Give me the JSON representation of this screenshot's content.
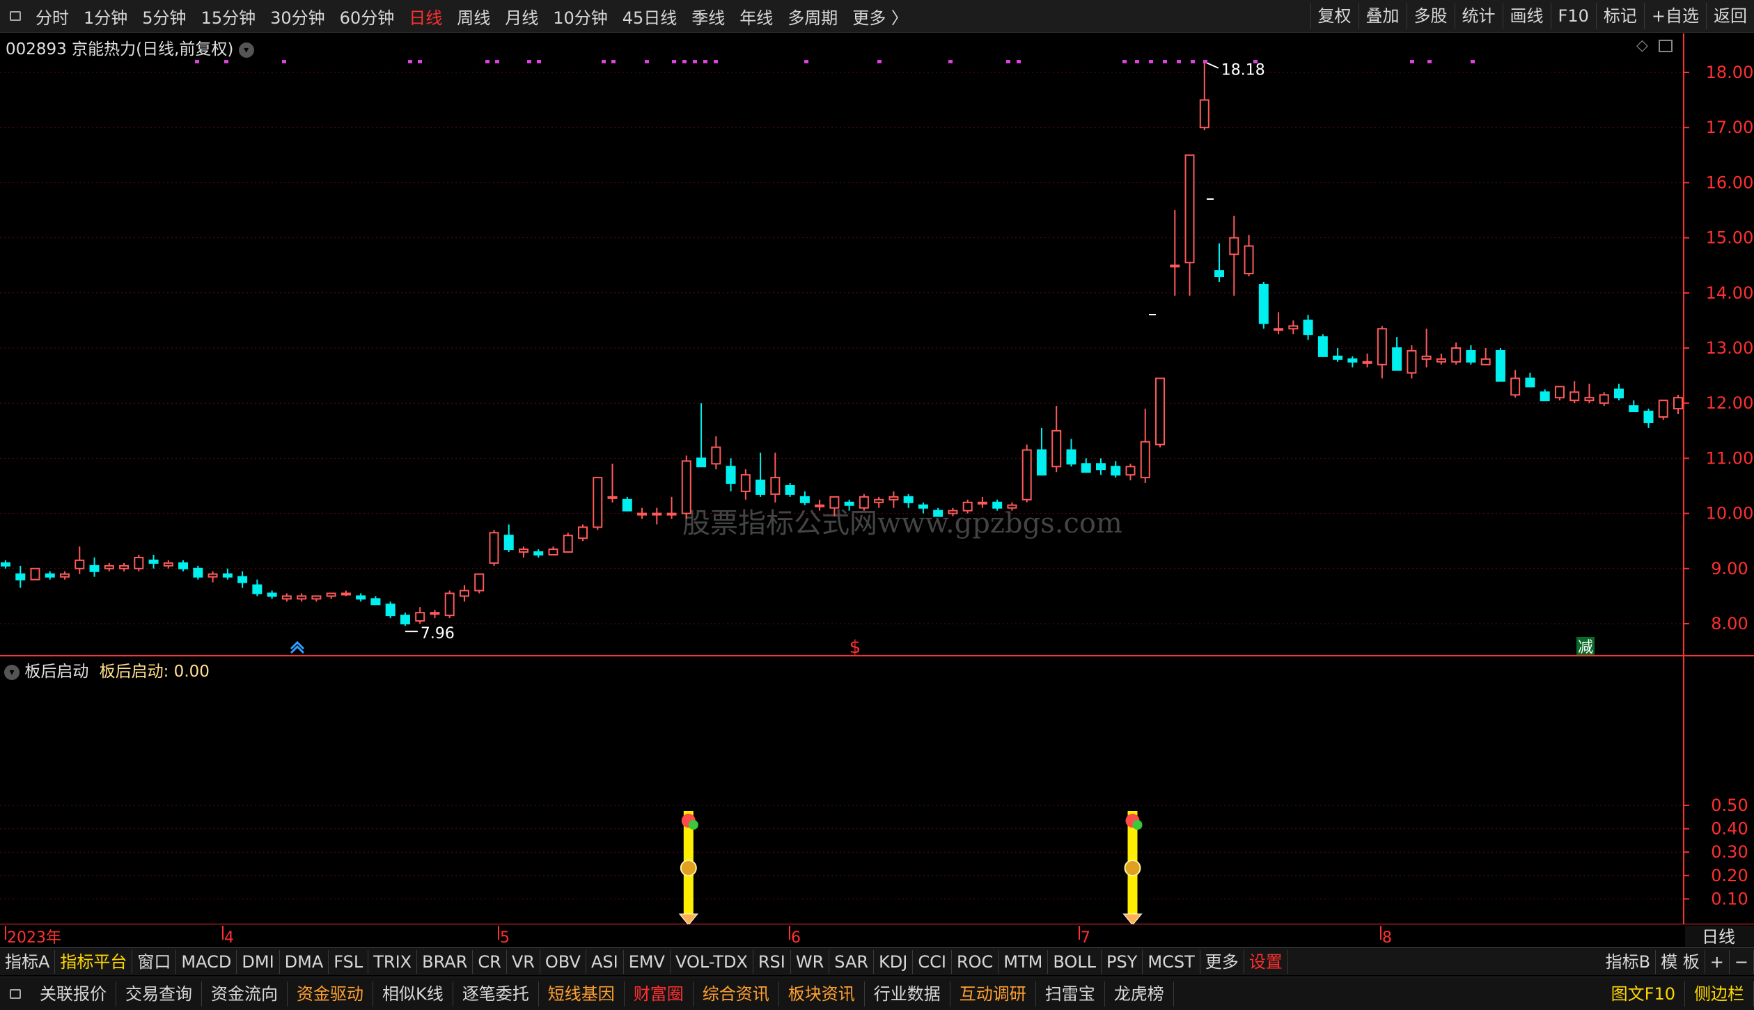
{
  "top_toolbar": {
    "periods": [
      {
        "label": "分时",
        "active": false
      },
      {
        "label": "1分钟",
        "active": false
      },
      {
        "label": "5分钟",
        "active": false
      },
      {
        "label": "15分钟",
        "active": false
      },
      {
        "label": "30分钟",
        "active": false
      },
      {
        "label": "60分钟",
        "active": false
      },
      {
        "label": "日线",
        "active": true
      },
      {
        "label": "周线",
        "active": false
      },
      {
        "label": "月线",
        "active": false
      },
      {
        "label": "10分钟",
        "active": false
      },
      {
        "label": "45日线",
        "active": false
      },
      {
        "label": "季线",
        "active": false
      },
      {
        "label": "年线",
        "active": false
      },
      {
        "label": "多周期",
        "active": false
      },
      {
        "label": "更多 〉",
        "active": false
      }
    ],
    "right_buttons": [
      "复权",
      "叠加",
      "多股",
      "统计",
      "画线",
      "F10",
      "标记",
      "+自选",
      "返回"
    ]
  },
  "main_panel": {
    "title": "002893 京能热力(日线,前复权)",
    "high_label": "18.18",
    "low_label": "7.96",
    "watermark": "股票指标公式网www.gpzbgs.com",
    "marker_reduce": "减",
    "marker_dollar": "$",
    "price_axis": [
      "18.00",
      "17.00",
      "16.00",
      "15.00",
      "14.00",
      "13.00",
      "12.00",
      "11.00",
      "10.00",
      "9.00",
      "8.00"
    ]
  },
  "sub_panel": {
    "title": "板后启动",
    "value_label": "板后启动: 0.00",
    "axis": [
      "0.50",
      "0.40",
      "0.30",
      "0.20",
      "0.10"
    ],
    "signal_icons": [
      "flower-icon",
      "dollar-coin-icon",
      "diamond-icon",
      "butterfly-icon"
    ]
  },
  "time_axis": {
    "labels": [
      "2023年",
      "4",
      "5",
      "6",
      "7",
      "8"
    ],
    "right_label": "日线"
  },
  "indicator_bar": {
    "items": [
      {
        "label": "指标A",
        "style": "normal"
      },
      {
        "label": "指标平台",
        "style": "hl"
      },
      {
        "label": "窗口",
        "style": "normal"
      },
      {
        "label": "MACD",
        "style": "normal"
      },
      {
        "label": "DMI",
        "style": "normal"
      },
      {
        "label": "DMA",
        "style": "normal"
      },
      {
        "label": "FSL",
        "style": "normal"
      },
      {
        "label": "TRIX",
        "style": "normal"
      },
      {
        "label": "BRAR",
        "style": "normal"
      },
      {
        "label": "CR",
        "style": "normal"
      },
      {
        "label": "VR",
        "style": "normal"
      },
      {
        "label": "OBV",
        "style": "normal"
      },
      {
        "label": "ASI",
        "style": "normal"
      },
      {
        "label": "EMV",
        "style": "normal"
      },
      {
        "label": "VOL-TDX",
        "style": "normal"
      },
      {
        "label": "RSI",
        "style": "normal"
      },
      {
        "label": "WR",
        "style": "normal"
      },
      {
        "label": "SAR",
        "style": "normal"
      },
      {
        "label": "KDJ",
        "style": "normal"
      },
      {
        "label": "CCI",
        "style": "normal"
      },
      {
        "label": "ROC",
        "style": "normal"
      },
      {
        "label": "MTM",
        "style": "normal"
      },
      {
        "label": "BOLL",
        "style": "normal"
      },
      {
        "label": "PSY",
        "style": "normal"
      },
      {
        "label": "MCST",
        "style": "normal"
      },
      {
        "label": "更多",
        "style": "normal"
      },
      {
        "label": "设置",
        "style": "red"
      }
    ],
    "right": [
      "指标B",
      "模 板",
      "+",
      "−"
    ]
  },
  "function_bar": {
    "items": [
      {
        "label": "关联报价",
        "color": "white"
      },
      {
        "label": "交易查询",
        "color": "white"
      },
      {
        "label": "资金流向",
        "color": "white"
      },
      {
        "label": "资金驱动",
        "color": "orange"
      },
      {
        "label": "相似K线",
        "color": "white"
      },
      {
        "label": "逐笔委托",
        "color": "white"
      },
      {
        "label": "短线基因",
        "color": "orange"
      },
      {
        "label": "财富圈",
        "color": "red"
      },
      {
        "label": "综合资讯",
        "color": "orange"
      },
      {
        "label": "板块资讯",
        "color": "orange"
      },
      {
        "label": "行业数据",
        "color": "white"
      },
      {
        "label": "互动调研",
        "color": "orange"
      },
      {
        "label": "扫雷宝",
        "color": "white"
      },
      {
        "label": "龙虎榜",
        "color": "white"
      }
    ],
    "right": [
      {
        "label": "图文F10",
        "color": "yellow"
      },
      {
        "label": "侧边栏",
        "color": "yellow"
      }
    ]
  },
  "colors": {
    "up": "#ff5a5a",
    "down": "#00f0f0",
    "grid": "#5a1010",
    "axis": "#ff3030",
    "signal": "#ffee00"
  },
  "chart_data": {
    "type": "candlestick",
    "ohlc": [
      [
        9.1,
        9.15,
        9.0,
        9.05
      ],
      [
        8.9,
        9.05,
        8.65,
        8.8
      ],
      [
        8.8,
        9.0,
        8.8,
        9.0
      ],
      [
        8.9,
        8.95,
        8.8,
        8.85
      ],
      [
        8.85,
        8.95,
        8.8,
        8.9
      ],
      [
        9.0,
        9.4,
        8.9,
        9.15
      ],
      [
        9.05,
        9.2,
        8.85,
        8.95
      ],
      [
        9.0,
        9.1,
        8.95,
        9.05
      ],
      [
        9.0,
        9.1,
        8.95,
        9.05
      ],
      [
        9.0,
        9.25,
        8.95,
        9.2
      ],
      [
        9.15,
        9.25,
        9.0,
        9.1
      ],
      [
        9.05,
        9.15,
        9.0,
        9.1
      ],
      [
        9.1,
        9.15,
        8.95,
        9.0
      ],
      [
        9.0,
        9.05,
        8.8,
        8.85
      ],
      [
        8.85,
        8.95,
        8.75,
        8.9
      ],
      [
        8.9,
        9.0,
        8.8,
        8.85
      ],
      [
        8.85,
        8.95,
        8.65,
        8.75
      ],
      [
        8.7,
        8.8,
        8.5,
        8.55
      ],
      [
        8.55,
        8.6,
        8.45,
        8.5
      ],
      [
        8.45,
        8.55,
        8.4,
        8.5
      ],
      [
        8.45,
        8.55,
        8.4,
        8.5
      ],
      [
        8.45,
        8.5,
        8.4,
        8.5
      ],
      [
        8.5,
        8.55,
        8.45,
        8.55
      ],
      [
        8.55,
        8.6,
        8.5,
        8.55
      ],
      [
        8.5,
        8.55,
        8.4,
        8.45
      ],
      [
        8.45,
        8.5,
        8.35,
        8.35
      ],
      [
        8.35,
        8.4,
        8.1,
        8.15
      ],
      [
        8.15,
        8.2,
        7.96,
        8.0
      ],
      [
        8.05,
        8.3,
        8.0,
        8.2
      ],
      [
        8.2,
        8.25,
        8.1,
        8.2
      ],
      [
        8.15,
        8.6,
        8.1,
        8.55
      ],
      [
        8.5,
        8.7,
        8.4,
        8.6
      ],
      [
        8.6,
        8.9,
        8.55,
        8.9
      ],
      [
        9.1,
        9.7,
        9.05,
        9.65
      ],
      [
        9.6,
        9.8,
        9.3,
        9.35
      ],
      [
        9.3,
        9.4,
        9.2,
        9.35
      ],
      [
        9.3,
        9.35,
        9.2,
        9.25
      ],
      [
        9.25,
        9.4,
        9.25,
        9.35
      ],
      [
        9.3,
        9.65,
        9.3,
        9.6
      ],
      [
        9.55,
        9.8,
        9.5,
        9.75
      ],
      [
        9.75,
        10.65,
        9.7,
        10.65
      ],
      [
        10.3,
        10.9,
        10.2,
        10.3
      ],
      [
        10.25,
        10.3,
        10.05,
        10.05
      ],
      [
        10.0,
        10.1,
        9.9,
        10.0
      ],
      [
        10.0,
        10.1,
        9.8,
        10.0
      ],
      [
        10.0,
        10.3,
        9.9,
        10.0
      ],
      [
        10.0,
        11.05,
        9.9,
        10.95
      ],
      [
        11.0,
        12.0,
        10.85,
        10.85
      ],
      [
        10.9,
        11.4,
        10.8,
        11.2
      ],
      [
        10.85,
        11.0,
        10.4,
        10.55
      ],
      [
        10.4,
        10.8,
        10.25,
        10.7
      ],
      [
        10.6,
        11.1,
        10.3,
        10.35
      ],
      [
        10.35,
        11.1,
        10.2,
        10.65
      ],
      [
        10.5,
        10.55,
        10.3,
        10.35
      ],
      [
        10.3,
        10.4,
        10.15,
        10.2
      ],
      [
        10.15,
        10.25,
        10.05,
        10.15
      ],
      [
        10.1,
        10.3,
        9.95,
        10.3
      ],
      [
        10.2,
        10.25,
        10.05,
        10.15
      ],
      [
        10.1,
        10.35,
        10.05,
        10.3
      ],
      [
        10.2,
        10.3,
        10.1,
        10.25
      ],
      [
        10.25,
        10.4,
        10.1,
        10.3
      ],
      [
        10.3,
        10.35,
        10.1,
        10.2
      ],
      [
        10.15,
        10.2,
        10.0,
        10.1
      ],
      [
        10.05,
        10.1,
        9.95,
        9.95
      ],
      [
        10.0,
        10.1,
        9.95,
        10.05
      ],
      [
        10.05,
        10.25,
        10.0,
        10.2
      ],
      [
        10.2,
        10.3,
        10.1,
        10.2
      ],
      [
        10.2,
        10.25,
        10.05,
        10.1
      ],
      [
        10.1,
        10.2,
        10.05,
        10.15
      ],
      [
        10.25,
        11.25,
        10.2,
        11.15
      ],
      [
        11.15,
        11.55,
        10.85,
        10.7
      ],
      [
        10.85,
        11.95,
        10.75,
        11.5
      ],
      [
        11.15,
        11.35,
        10.85,
        10.9
      ],
      [
        10.9,
        11.0,
        10.75,
        10.75
      ],
      [
        10.9,
        11.0,
        10.7,
        10.8
      ],
      [
        10.85,
        10.95,
        10.65,
        10.7
      ],
      [
        10.7,
        10.9,
        10.6,
        10.85
      ],
      [
        10.65,
        11.9,
        10.55,
        11.3
      ],
      [
        11.25,
        12.45,
        11.2,
        12.45
      ],
      [
        14.5,
        15.5,
        13.95,
        14.5
      ],
      [
        14.55,
        16.5,
        13.95,
        16.5
      ],
      [
        17.0,
        18.18,
        16.95,
        17.5
      ],
      [
        14.4,
        14.9,
        14.2,
        14.3
      ],
      [
        14.7,
        15.4,
        13.95,
        15.0
      ],
      [
        14.35,
        15.05,
        14.3,
        14.85
      ],
      [
        14.15,
        14.2,
        13.35,
        13.45
      ],
      [
        13.35,
        13.65,
        13.25,
        13.35
      ],
      [
        13.35,
        13.5,
        13.25,
        13.4
      ],
      [
        13.5,
        13.6,
        13.15,
        13.25
      ],
      [
        13.2,
        13.25,
        12.85,
        12.85
      ],
      [
        12.85,
        13.0,
        12.75,
        12.8
      ],
      [
        12.8,
        12.85,
        12.65,
        12.75
      ],
      [
        12.75,
        12.9,
        12.65,
        12.75
      ],
      [
        12.7,
        13.4,
        12.45,
        13.35
      ],
      [
        13.0,
        13.2,
        12.6,
        12.6
      ],
      [
        12.55,
        13.05,
        12.45,
        12.95
      ],
      [
        12.8,
        13.35,
        12.65,
        12.85
      ],
      [
        12.75,
        12.9,
        12.7,
        12.8
      ],
      [
        12.75,
        13.1,
        12.7,
        13.0
      ],
      [
        12.95,
        13.05,
        12.7,
        12.75
      ],
      [
        12.7,
        13.0,
        12.7,
        12.8
      ],
      [
        12.95,
        13.0,
        12.4,
        12.4
      ],
      [
        12.15,
        12.6,
        12.1,
        12.45
      ],
      [
        12.45,
        12.55,
        12.3,
        12.3
      ],
      [
        12.2,
        12.25,
        12.05,
        12.05
      ],
      [
        12.1,
        12.3,
        12.05,
        12.3
      ],
      [
        12.05,
        12.4,
        12.0,
        12.2
      ],
      [
        12.05,
        12.35,
        12.0,
        12.1
      ],
      [
        12.0,
        12.2,
        11.95,
        12.15
      ],
      [
        12.25,
        12.35,
        12.05,
        12.1
      ],
      [
        11.95,
        12.05,
        11.85,
        11.85
      ],
      [
        11.85,
        11.9,
        11.55,
        11.65
      ],
      [
        11.75,
        12.05,
        11.7,
        12.05
      ],
      [
        11.9,
        12.15,
        11.8,
        12.1
      ]
    ],
    "signal_bars": [
      {
        "index": 46,
        "value": 0.5
      },
      {
        "index": 76,
        "value": 0.5
      }
    ]
  }
}
